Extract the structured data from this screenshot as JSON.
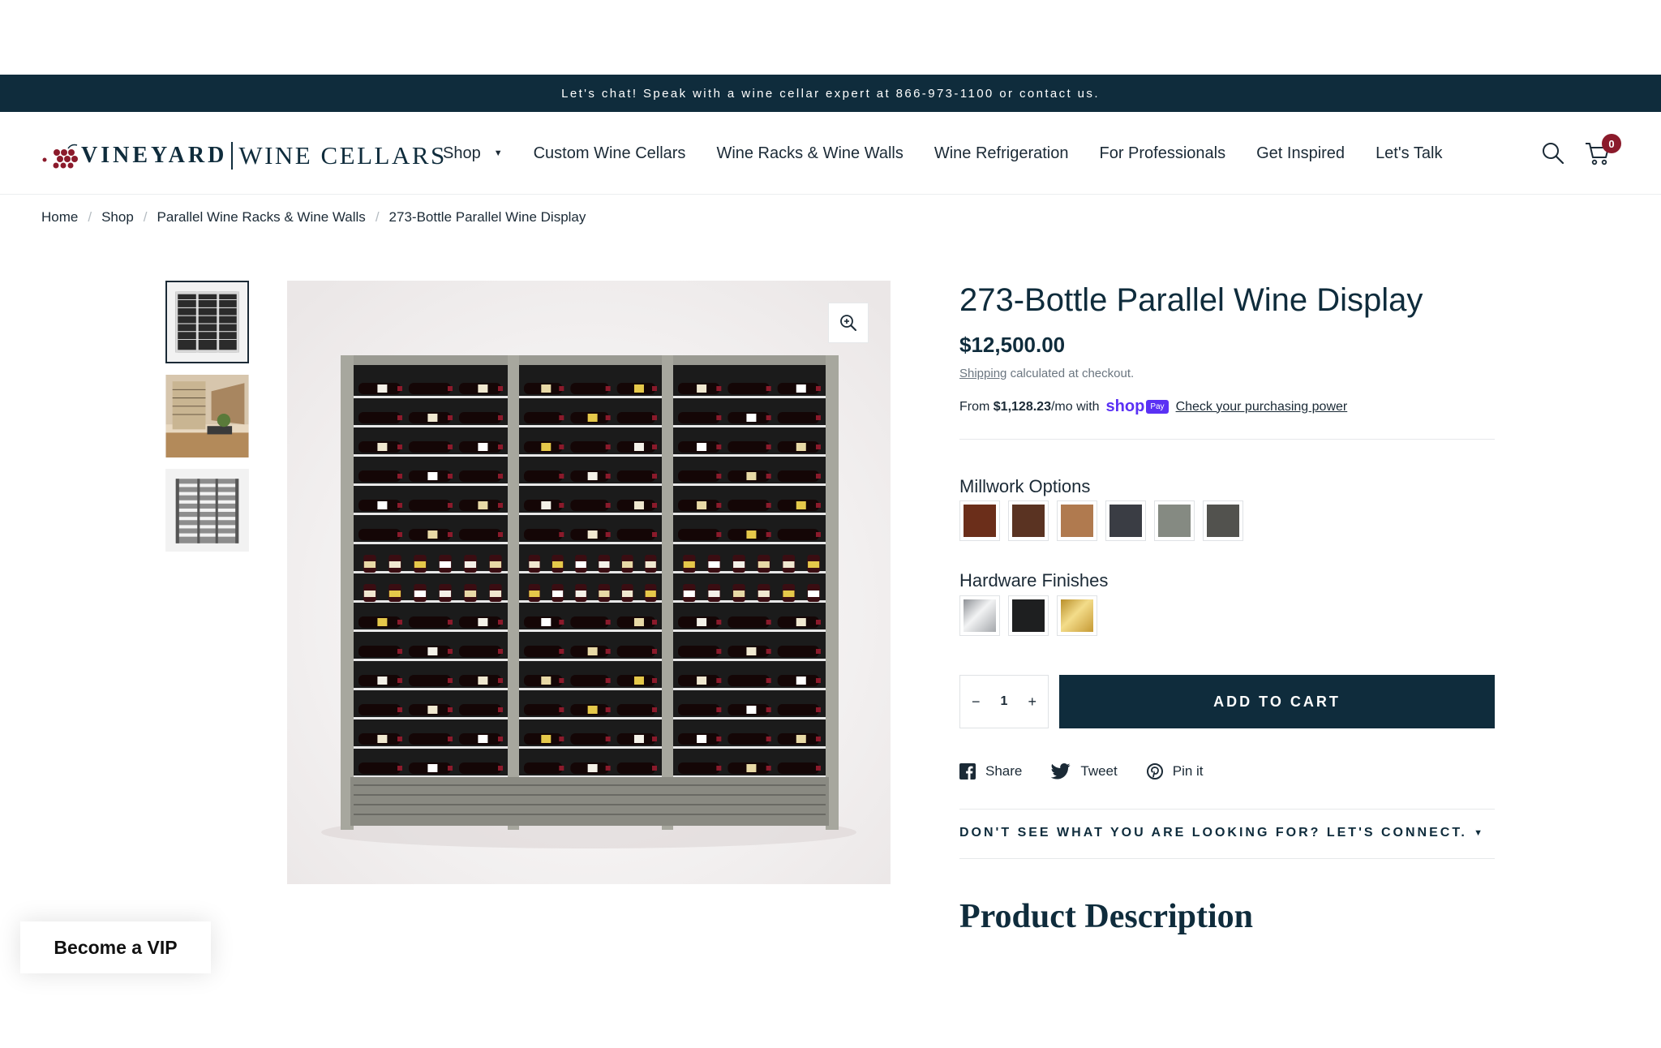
{
  "announcement": "Let's chat! Speak with a wine cellar expert at 866-973-1100 or contact us.",
  "logo": {
    "part1": "VINEYARD",
    "part2": "WINE CELLARS"
  },
  "nav": [
    "Shop",
    "Custom Wine Cellars",
    "Wine Racks & Wine Walls",
    "Wine Refrigeration",
    "For Professionals",
    "Get Inspired",
    "Let's Talk"
  ],
  "cart": {
    "count": "0"
  },
  "breadcrumb": [
    "Home",
    "Shop",
    "Parallel Wine Racks & Wine Walls",
    "273-Bottle Parallel Wine Display"
  ],
  "product": {
    "title": "273-Bottle Parallel Wine Display",
    "price": "$12,500.00",
    "shipping_link": "Shipping",
    "shipping_text": "calculated at checkout.",
    "installment_prefix": "From",
    "installment_amount": "$1,128.23",
    "installment_suffix": "/mo with",
    "shop_word": "shop",
    "pay_badge": "Pay",
    "installment_link": "Check your purchasing power"
  },
  "millwork": {
    "label": "Millwork Options",
    "swatches": [
      "#6b2e1a",
      "#5a3322",
      "#b07a4f",
      "#3a3d44",
      "#858a82",
      "#52524e"
    ]
  },
  "hardware": {
    "label": "Hardware Finishes",
    "swatches": [
      "#c9cbce",
      "#1e1f20",
      "#d9b54a"
    ]
  },
  "quantity": {
    "minus": "−",
    "value": "1",
    "plus": "+"
  },
  "add_to_cart": "ADD TO CART",
  "social": [
    "Share",
    "Tweet",
    "Pin it"
  ],
  "connect": "DON'T SEE WHAT YOU ARE LOOKING FOR? LET'S CONNECT.",
  "description_title": "Product Description",
  "vip": "Become a VIP"
}
